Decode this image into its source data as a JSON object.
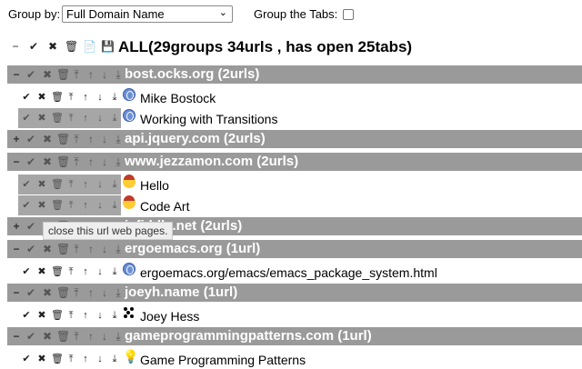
{
  "toolbar": {
    "group_by_label": "Group by:",
    "group_by_value": "Full Domain Name",
    "group_tabs_label": "Group the Tabs:"
  },
  "all": {
    "title": "ALL(29groups 34urls , has open 25tabs)"
  },
  "icons": {
    "collapse": "−",
    "expand": "+",
    "check": "✔",
    "close": "✖",
    "trash": "🗑",
    "top": "⤒",
    "up": "↑",
    "down": "↓",
    "bottom": "⤓",
    "doc": "📄",
    "save": "💾"
  },
  "groups": [
    {
      "title": "bost.ocks.org (2urls)",
      "toggle": "−",
      "items": [
        {
          "title": "Mike Bostock",
          "favicon": "globe",
          "highlighted": false
        },
        {
          "title": "Working with Transitions",
          "favicon": "globe",
          "highlighted": true
        }
      ]
    },
    {
      "title": "api.jquery.com (2urls)",
      "toggle": "+",
      "items": []
    },
    {
      "title": "www.jezzamon.com (2urls)",
      "toggle": "−",
      "items": [
        {
          "title": "Hello",
          "favicon": "face",
          "highlighted": true
        },
        {
          "title": "Code Art",
          "favicon": "face",
          "highlighted": true
        }
      ]
    },
    {
      "title": "jsfiddle.net (2urls)",
      "toggle": "+",
      "items": []
    },
    {
      "title": "ergoemacs.org (1url)",
      "toggle": "−",
      "items": [
        {
          "title": "ergoemacs.org/emacs/emacs_package_system.html",
          "favicon": "globe",
          "highlighted": false
        }
      ]
    },
    {
      "title": "joeyh.name (1url)",
      "toggle": "−",
      "items": [
        {
          "title": "Joey Hess",
          "favicon": "dots",
          "highlighted": false
        }
      ]
    },
    {
      "title": "gameprogrammingpatterns.com (1url)",
      "toggle": "−",
      "items": [
        {
          "title": "Game Programming Patterns",
          "favicon": "bulb",
          "highlighted": false
        }
      ]
    }
  ],
  "tooltip": {
    "text": "close this url web pages."
  }
}
